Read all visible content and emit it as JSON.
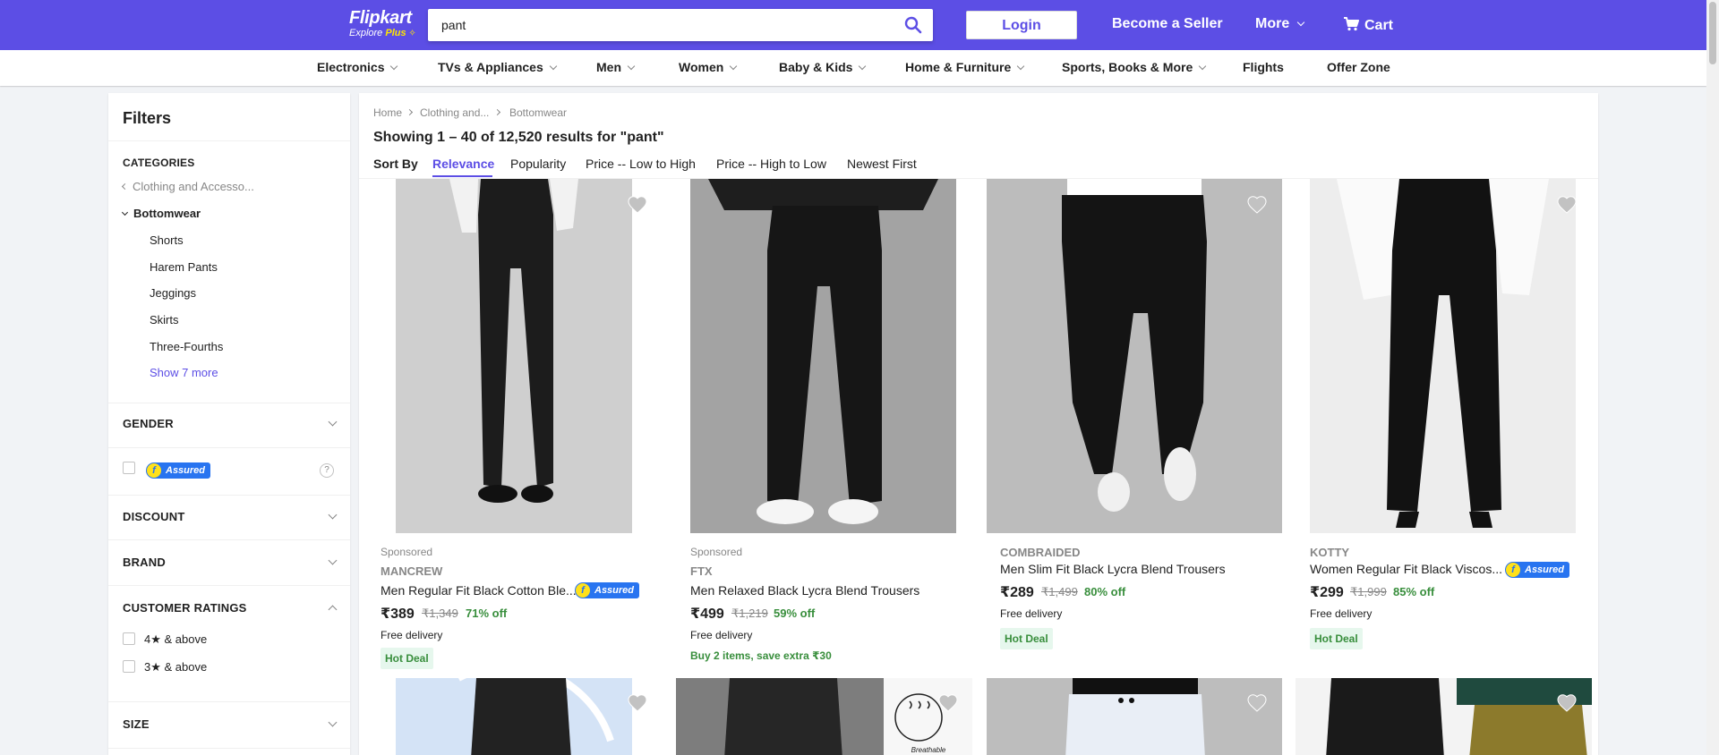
{
  "header": {
    "logo_brand": "Flipkart",
    "logo_sub_prefix": "Explore",
    "logo_sub_plus": "Plus",
    "search_value": "pant",
    "login_label": "Login",
    "seller_label": "Become a Seller",
    "more_label": "More",
    "cart_label": "Cart",
    "accent_color": "#5c4ee5"
  },
  "categories": [
    {
      "label": "Electronics",
      "chevron": true
    },
    {
      "label": "TVs & Appliances",
      "chevron": true
    },
    {
      "label": "Men",
      "chevron": true
    },
    {
      "label": "Women",
      "chevron": true
    },
    {
      "label": "Baby & Kids",
      "chevron": true
    },
    {
      "label": "Home & Furniture",
      "chevron": true
    },
    {
      "label": "Sports, Books & More",
      "chevron": true
    },
    {
      "label": "Flights",
      "chevron": false
    },
    {
      "label": "Offer Zone",
      "chevron": false
    }
  ],
  "filters": {
    "title": "Filters",
    "categories_heading": "CATEGORIES",
    "parent_category": "Clothing and Accesso...",
    "current_category": "Bottomwear",
    "subcategories": [
      "Shorts",
      "Harem Pants",
      "Jeggings",
      "Skirts",
      "Three-Fourths"
    ],
    "show_more": "Show 7 more",
    "gender_heading": "GENDER",
    "assured_label": "Assured",
    "assured_help": "?",
    "discount_heading": "DISCOUNT",
    "brand_heading": "BRAND",
    "ratings_heading": "CUSTOMER RATINGS",
    "ratings_options": [
      "4★ & above",
      "3★ & above"
    ],
    "size_heading": "SIZE"
  },
  "breadcrumb": [
    "Home",
    "Clothing and...",
    "Bottomwear"
  ],
  "results_text": "Showing 1 – 40 of 12,520 results for \"pant\"",
  "sort": {
    "label": "Sort By",
    "options": [
      "Relevance",
      "Popularity",
      "Price -- Low to High",
      "Price -- High to Low",
      "Newest First"
    ],
    "active": "Relevance"
  },
  "products": [
    {
      "sponsored": "Sponsored",
      "brand": "MANCREW",
      "title": "Men Regular Fit Black Cotton Ble...",
      "assured": true,
      "price": "₹389",
      "mrp": "₹1,349",
      "off": "71% off",
      "delivery": "Free delivery",
      "deal": "Hot Deal",
      "offer": ""
    },
    {
      "sponsored": "Sponsored",
      "brand": "FTX",
      "title": "Men Relaxed Black Lycra Blend Trousers",
      "assured": false,
      "price": "₹499",
      "mrp": "₹1,219",
      "off": "59% off",
      "delivery": "Free delivery",
      "deal": "",
      "offer": "Buy 2 items, save extra ₹30"
    },
    {
      "sponsored": "",
      "brand": "COMBRAIDED",
      "title": "Men Slim Fit Black Lycra Blend Trousers",
      "assured": false,
      "price": "₹289",
      "mrp": "₹1,499",
      "off": "80% off",
      "delivery": "Free delivery",
      "deal": "Hot Deal",
      "offer": ""
    },
    {
      "sponsored": "",
      "brand": "KOTTY",
      "title": "Women Regular Fit Black Viscos...",
      "assured": true,
      "price": "₹299",
      "mrp": "₹1,999",
      "off": "85% off",
      "delivery": "Free delivery",
      "deal": "Hot Deal",
      "offer": ""
    }
  ],
  "second_row_badge": "Breathable"
}
